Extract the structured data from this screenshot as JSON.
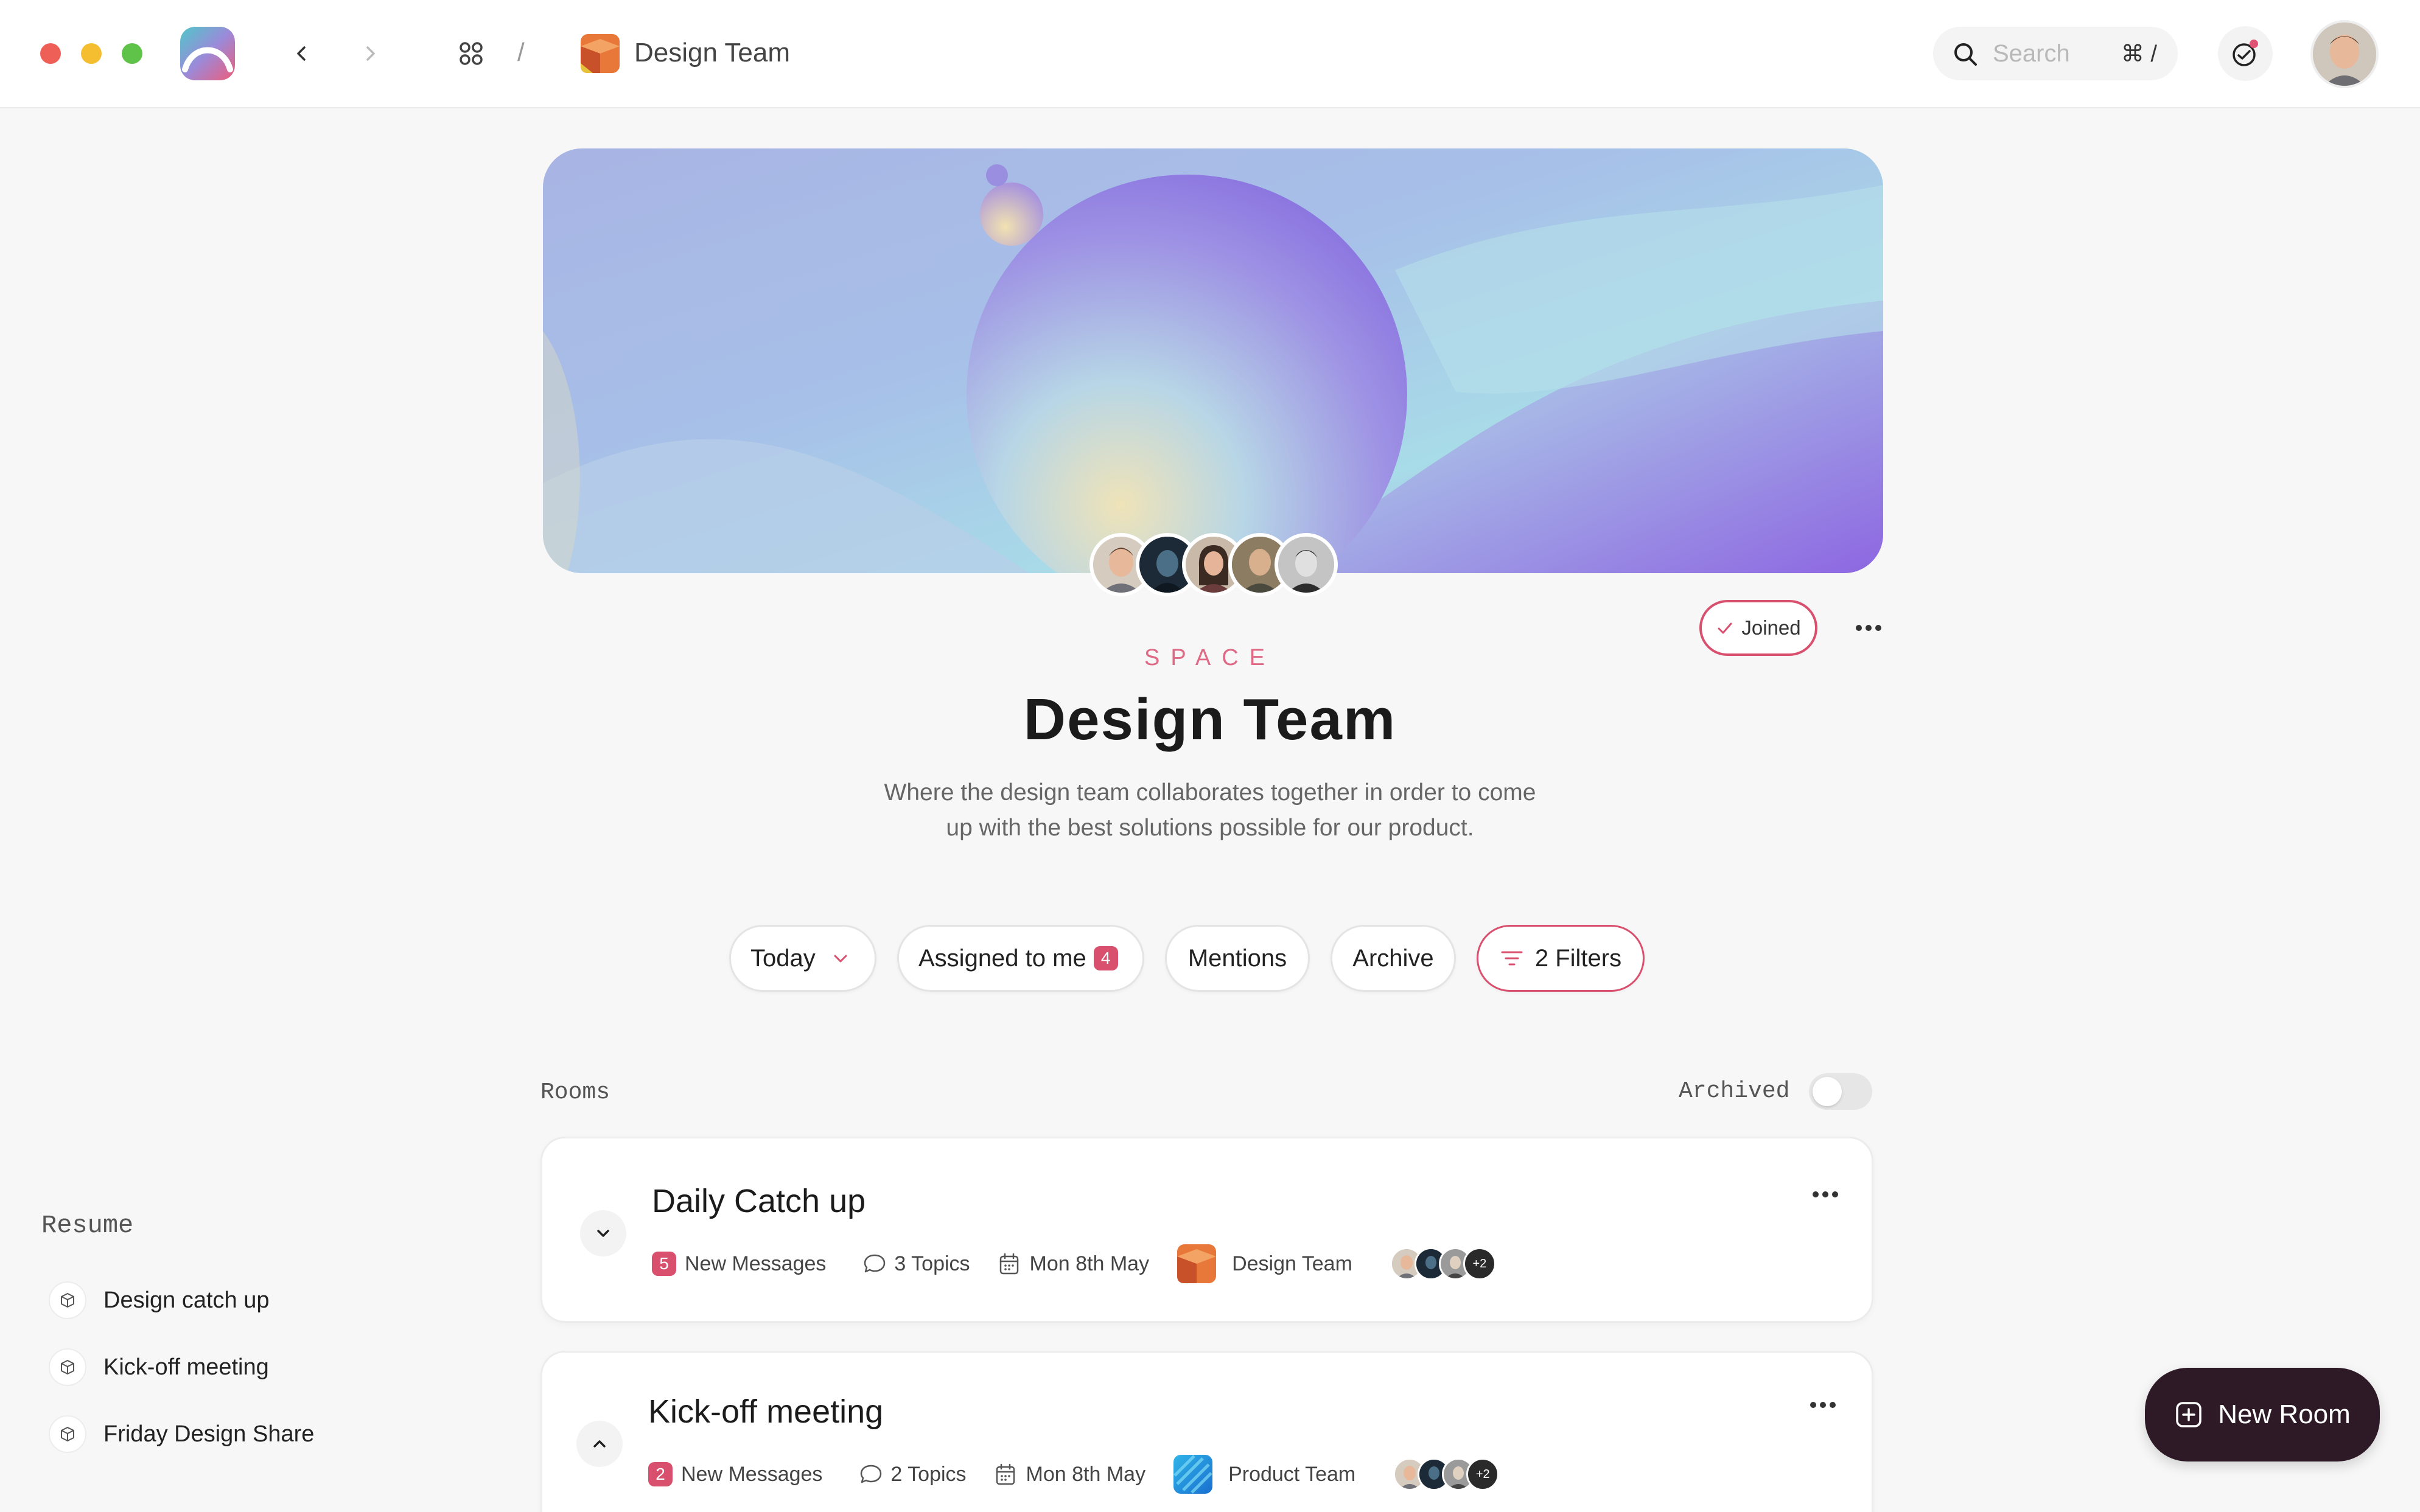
{
  "header": {
    "breadcrumb_separator": "/",
    "space_name": "Design Team",
    "search_placeholder": "Search",
    "search_shortcut": "⌘ /"
  },
  "space": {
    "eyebrow": "SPACE",
    "title": "Design Team",
    "description_line1": "Where the design team collaborates together in order to come",
    "description_line2": "up with the best solutions possible for our product.",
    "joined_label": "Joined"
  },
  "filters": {
    "today": "Today",
    "assigned": "Assigned to me",
    "assigned_count": "4",
    "mentions": "Mentions",
    "archive": "Archive",
    "filters": "2 Filters"
  },
  "rooms": {
    "heading": "Rooms",
    "archived_label": "Archived",
    "items": [
      {
        "title": "Daily Catch up",
        "new_count": "5",
        "new_label": "New Messages",
        "topics": "3 Topics",
        "date": "Mon 8th May",
        "team": "Design Team",
        "extra": "+2"
      },
      {
        "title": "Kick-off meeting",
        "new_count": "2",
        "new_label": "New Messages",
        "topics": "2 Topics",
        "date": "Mon 8th May",
        "team": "Product Team",
        "extra": "+2"
      }
    ]
  },
  "sidebar": {
    "heading": "Resume",
    "items": [
      {
        "label": "Design catch up"
      },
      {
        "label": "Kick-off meeting"
      },
      {
        "label": "Friday Design Share"
      }
    ]
  },
  "new_room_label": "New Room",
  "colors": {
    "accent": "#d9506e",
    "dark_button": "#2e1a26"
  }
}
